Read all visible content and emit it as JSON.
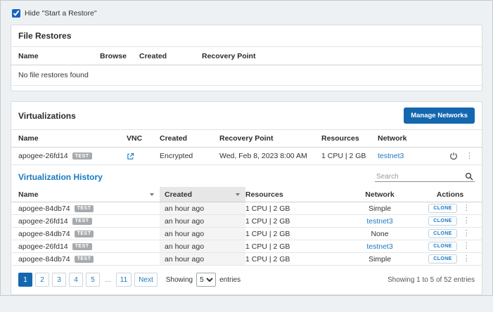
{
  "controls": {
    "hide_restore_label": "Hide \"Start a Restore\"",
    "hide_restore_checked": true
  },
  "file_restores": {
    "title": "File Restores",
    "columns": [
      "Name",
      "Browse",
      "Created",
      "Recovery Point"
    ],
    "empty_message": "No file restores found"
  },
  "virtualizations": {
    "title": "Virtualizations",
    "manage_networks_label": "Manage Networks",
    "columns": [
      "Name",
      "VNC",
      "Created",
      "Recovery Point",
      "Resources",
      "Network"
    ],
    "rows": [
      {
        "name": "apogee-26fd14",
        "badge": "TEST",
        "created": "Encrypted",
        "recovery_point": "Wed, Feb 8, 2023 8:00 AM",
        "resources": "1 CPU | 2 GB",
        "network": "testnet3"
      }
    ]
  },
  "history": {
    "title": "Virtualization History",
    "search_placeholder": "Search",
    "columns": [
      "Name",
      "Created",
      "Resources",
      "Network",
      "Actions"
    ],
    "rows": [
      {
        "name": "apogee-84db74",
        "badge": "TEST",
        "created": "an hour ago",
        "resources": "1 CPU | 2 GB",
        "network": "Simple",
        "network_is_link": false,
        "action": "CLONE"
      },
      {
        "name": "apogee-26fd14",
        "badge": "TEST",
        "created": "an hour ago",
        "resources": "1 CPU | 2 GB",
        "network": "testnet3",
        "network_is_link": true,
        "action": "CLONE"
      },
      {
        "name": "apogee-84db74",
        "badge": "TEST",
        "created": "an hour ago",
        "resources": "1 CPU | 2 GB",
        "network": "None",
        "network_is_link": false,
        "action": "CLONE"
      },
      {
        "name": "apogee-26fd14",
        "badge": "TEST",
        "created": "an hour ago",
        "resources": "1 CPU | 2 GB",
        "network": "testnet3",
        "network_is_link": true,
        "action": "CLONE"
      },
      {
        "name": "apogee-84db74",
        "badge": "TEST",
        "created": "an hour ago",
        "resources": "1 CPU | 2 GB",
        "network": "Simple",
        "network_is_link": false,
        "action": "CLONE"
      }
    ],
    "pagination": {
      "pages": [
        "1",
        "2",
        "3",
        "4",
        "5"
      ],
      "ellipsis": "...",
      "last_page": "11",
      "next_label": "Next",
      "showing_prefix": "Showing",
      "page_size": "5",
      "entries_suffix": "entries",
      "summary": "Showing 1 to 5 of 52 entries"
    }
  }
}
